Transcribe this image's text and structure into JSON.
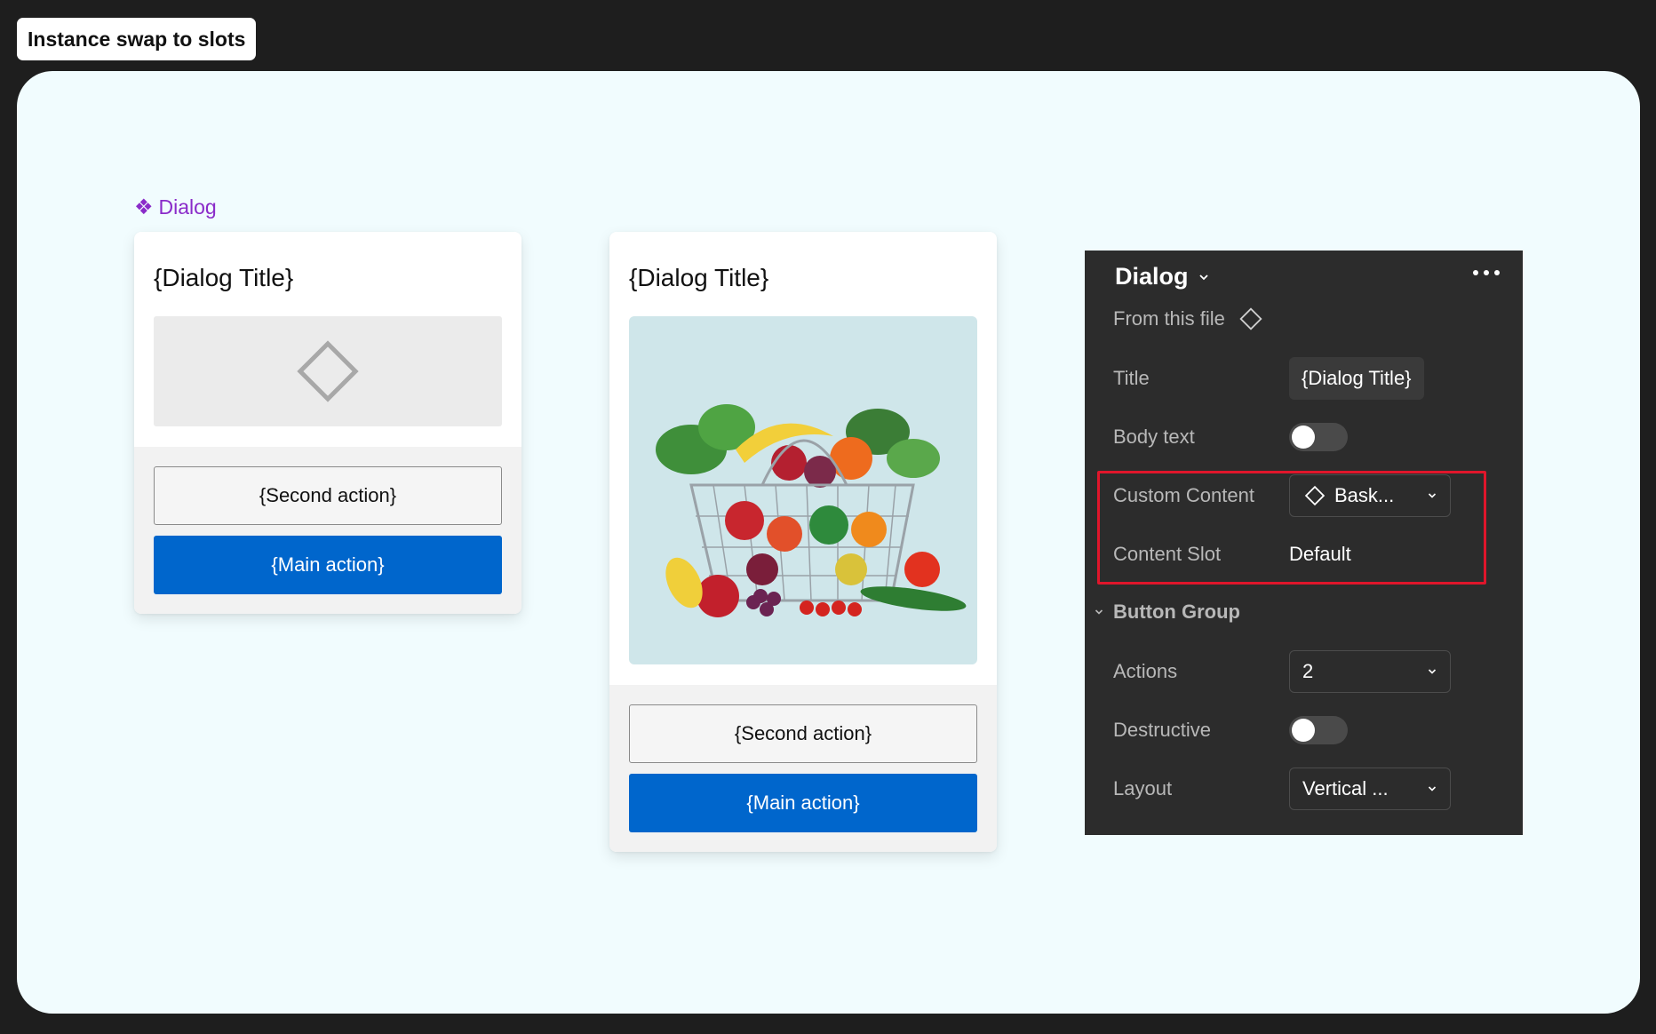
{
  "tag": {
    "label": "Instance swap to slots"
  },
  "component_label": {
    "glyph": "❖",
    "text": "Dialog"
  },
  "dialog_left": {
    "title": "{Dialog Title}",
    "second_action": "{Second action}",
    "main_action": "{Main action}"
  },
  "dialog_right": {
    "title": "{Dialog Title}",
    "second_action": "{Second action}",
    "main_action": "{Main action}"
  },
  "panel": {
    "title": "Dialog",
    "source": "From this file",
    "rows": {
      "title": {
        "label": "Title",
        "value": "{Dialog Title}"
      },
      "body_text": {
        "label": "Body text",
        "on": false
      },
      "custom_content": {
        "label": "Custom Content",
        "value": "Bask..."
      },
      "content_slot": {
        "label": "Content Slot",
        "value": "Default"
      }
    },
    "section": "Button Group",
    "rows2": {
      "actions": {
        "label": "Actions",
        "value": "2"
      },
      "destructive": {
        "label": "Destructive",
        "on": false
      },
      "layout": {
        "label": "Layout",
        "value": "Vertical ..."
      }
    }
  },
  "colors": {
    "primary": "#0066cc",
    "highlight": "#e0162b",
    "component_purple": "#8a2bc9"
  }
}
